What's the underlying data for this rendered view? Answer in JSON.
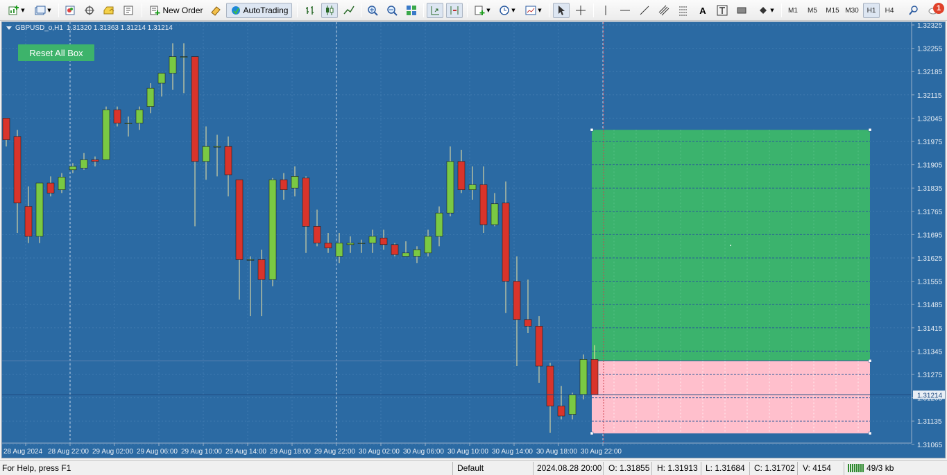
{
  "toolbar": {
    "new_order_label": "New Order",
    "autotrading_label": "AutoTrading",
    "timeframes": [
      "M1",
      "M5",
      "M15",
      "M30",
      "H1",
      "H4"
    ],
    "active_timeframe": "H1",
    "notification_count": "1",
    "icons": [
      "new-chart-icon",
      "profiles-icon",
      "market-watch-icon",
      "navigator-icon",
      "data-window-icon",
      "terminal-icon",
      "new-order-icon",
      "metaeditor-icon",
      "autotrading-icon",
      "bar-chart-icon",
      "candlesticks-icon",
      "line-chart-icon",
      "zoom-in-icon",
      "zoom-out-icon",
      "tile-windows-icon",
      "auto-scroll-icon",
      "chart-shift-icon",
      "indicators-icon",
      "periods-icon",
      "templates-icon",
      "cursor-icon",
      "crosshair-icon",
      "vertical-line-icon",
      "horizontal-line-icon",
      "trendline-icon",
      "equidistant-channel-icon",
      "fibonacci-icon",
      "text-icon",
      "text-label-icon",
      "rectangle-icon",
      "arrows-icon",
      "search-icon",
      "speech-bubble-icon"
    ]
  },
  "chart": {
    "symbol_label": "GBPUSD_o,H1",
    "ohlc_label": "1.31320 1.31363 1.31214 1.31214",
    "reset_button_label": "Reset All Box",
    "current_price_label": "1.31214",
    "colors": {
      "background": "#2b6aa3",
      "bull": "#7ac943",
      "bear": "#d9342b",
      "grid": "#3f7ab0",
      "profit_box": "#3bb36d",
      "loss_box": "#ffbfcc"
    },
    "price_axis": [
      "1.32325",
      "1.32255",
      "1.32185",
      "1.32115",
      "1.32045",
      "1.31975",
      "1.31905",
      "1.31835",
      "1.31765",
      "1.31695",
      "1.31625",
      "1.31555",
      "1.31485",
      "1.31415",
      "1.31345",
      "1.31275",
      "1.31205",
      "1.31135",
      "1.31065"
    ],
    "time_axis": [
      "28 Aug 2024",
      "28 Aug 22:00",
      "29 Aug 02:00",
      "29 Aug 06:00",
      "29 Aug 10:00",
      "29 Aug 14:00",
      "29 Aug 18:00",
      "29 Aug 22:00",
      "30 Aug 02:00",
      "30 Aug 06:00",
      "30 Aug 10:00",
      "30 Aug 14:00",
      "30 Aug 18:00",
      "30 Aug 22:00"
    ],
    "candles": [
      {
        "o": 1.32045,
        "h": 1.32045,
        "l": 1.3196,
        "c": 1.3198
      },
      {
        "o": 1.3199,
        "h": 1.3201,
        "l": 1.317,
        "c": 1.3179
      },
      {
        "o": 1.3178,
        "h": 1.3184,
        "l": 1.3167,
        "c": 1.3169
      },
      {
        "o": 1.3169,
        "h": 1.318,
        "l": 1.3167,
        "c": 1.3185
      },
      {
        "o": 1.3185,
        "h": 1.3187,
        "l": 1.3181,
        "c": 1.3182
      },
      {
        "o": 1.3183,
        "h": 1.3188,
        "l": 1.3182,
        "c": 1.31868
      },
      {
        "o": 1.3189,
        "h": 1.3191,
        "l": 1.3188,
        "c": 1.319
      },
      {
        "o": 1.31895,
        "h": 1.3194,
        "l": 1.3189,
        "c": 1.3192
      },
      {
        "o": 1.3192,
        "h": 1.3193,
        "l": 1.319,
        "c": 1.31915
      },
      {
        "o": 1.3192,
        "h": 1.3208,
        "l": 1.3192,
        "c": 1.3207
      },
      {
        "o": 1.3207,
        "h": 1.3208,
        "l": 1.3202,
        "c": 1.3203
      },
      {
        "o": 1.3203,
        "h": 1.3205,
        "l": 1.3199,
        "c": 1.3203
      },
      {
        "o": 1.3203,
        "h": 1.3208,
        "l": 1.3201,
        "c": 1.3207
      },
      {
        "o": 1.3208,
        "h": 1.3215,
        "l": 1.3206,
        "c": 1.32135
      },
      {
        "o": 1.3215,
        "h": 1.3218,
        "l": 1.3211,
        "c": 1.3218
      },
      {
        "o": 1.3218,
        "h": 1.3227,
        "l": 1.3213,
        "c": 1.3223
      },
      {
        "o": 1.3223,
        "h": 1.3227,
        "l": 1.3212,
        "c": 1.3223
      },
      {
        "o": 1.3223,
        "h": 1.3223,
        "l": 1.3172,
        "c": 1.31915
      },
      {
        "o": 1.31915,
        "h": 1.3202,
        "l": 1.3186,
        "c": 1.3196
      },
      {
        "o": 1.3196,
        "h": 1.31995,
        "l": 1.3187,
        "c": 1.3196
      },
      {
        "o": 1.3196,
        "h": 1.3199,
        "l": 1.3181,
        "c": 1.31875
      },
      {
        "o": 1.3186,
        "h": 1.3186,
        "l": 1.315,
        "c": 1.3162
      },
      {
        "o": 1.3162,
        "h": 1.3163,
        "l": 1.3145,
        "c": 1.3162
      },
      {
        "o": 1.3162,
        "h": 1.3165,
        "l": 1.3145,
        "c": 1.3156
      },
      {
        "o": 1.3156,
        "h": 1.31865,
        "l": 1.3154,
        "c": 1.3186
      },
      {
        "o": 1.3186,
        "h": 1.3188,
        "l": 1.318,
        "c": 1.3183
      },
      {
        "o": 1.31835,
        "h": 1.319,
        "l": 1.3181,
        "c": 1.3187
      },
      {
        "o": 1.31865,
        "h": 1.3187,
        "l": 1.3164,
        "c": 1.3172
      },
      {
        "o": 1.3172,
        "h": 1.3177,
        "l": 1.3166,
        "c": 1.3167
      },
      {
        "o": 1.3167,
        "h": 1.317,
        "l": 1.3164,
        "c": 1.31655
      },
      {
        "o": 1.3163,
        "h": 1.317,
        "l": 1.3161,
        "c": 1.3167
      },
      {
        "o": 1.31665,
        "h": 1.3169,
        "l": 1.3164,
        "c": 1.3167
      },
      {
        "o": 1.3167,
        "h": 1.3168,
        "l": 1.3164,
        "c": 1.3167
      },
      {
        "o": 1.3167,
        "h": 1.3171,
        "l": 1.3164,
        "c": 1.3169
      },
      {
        "o": 1.31685,
        "h": 1.3171,
        "l": 1.3165,
        "c": 1.31665
      },
      {
        "o": 1.31665,
        "h": 1.3167,
        "l": 1.3163,
        "c": 1.31635
      },
      {
        "o": 1.3163,
        "h": 1.31675,
        "l": 1.3163,
        "c": 1.3164
      },
      {
        "o": 1.3163,
        "h": 1.3166,
        "l": 1.3161,
        "c": 1.3165
      },
      {
        "o": 1.3164,
        "h": 1.3171,
        "l": 1.3163,
        "c": 1.3169
      },
      {
        "o": 1.3169,
        "h": 1.3178,
        "l": 1.3166,
        "c": 1.3176
      },
      {
        "o": 1.3176,
        "h": 1.3196,
        "l": 1.3175,
        "c": 1.31915
      },
      {
        "o": 1.31915,
        "h": 1.3195,
        "l": 1.3182,
        "c": 1.3183
      },
      {
        "o": 1.3183,
        "h": 1.319,
        "l": 1.318,
        "c": 1.31845
      },
      {
        "o": 1.31845,
        "h": 1.319,
        "l": 1.317,
        "c": 1.31725
      },
      {
        "o": 1.31725,
        "h": 1.3182,
        "l": 1.3172,
        "c": 1.31788
      },
      {
        "o": 1.3179,
        "h": 1.31855,
        "l": 1.3146,
        "c": 1.31555
      },
      {
        "o": 1.31555,
        "h": 1.3163,
        "l": 1.313,
        "c": 1.3144
      },
      {
        "o": 1.3144,
        "h": 1.3156,
        "l": 1.314,
        "c": 1.3142
      },
      {
        "o": 1.3142,
        "h": 1.3145,
        "l": 1.3125,
        "c": 1.313
      },
      {
        "o": 1.313,
        "h": 1.3131,
        "l": 1.311,
        "c": 1.3118
      },
      {
        "o": 1.3118,
        "h": 1.3124,
        "l": 1.3114,
        "c": 1.3115
      },
      {
        "o": 1.31155,
        "h": 1.3122,
        "l": 1.3114,
        "c": 1.31215
      },
      {
        "o": 1.31215,
        "h": 1.31335,
        "l": 1.312,
        "c": 1.3132
      },
      {
        "o": 1.3132,
        "h": 1.31363,
        "l": 1.31214,
        "c": 1.31214
      }
    ],
    "profit_box": {
      "top": 1.3201,
      "bottom": 1.31316
    },
    "loss_box": {
      "top": 1.31316,
      "bottom": 1.31098
    }
  },
  "statusbar": {
    "help": "For Help, press F1",
    "profile": "Default",
    "datetime": "2024.08.28 20:00",
    "open": "O: 1.31855",
    "high": "H: 1.31913",
    "low": "L: 1.31684",
    "close": "C: 1.31702",
    "volume": "V: 4154",
    "traffic": "49/3 kb"
  }
}
